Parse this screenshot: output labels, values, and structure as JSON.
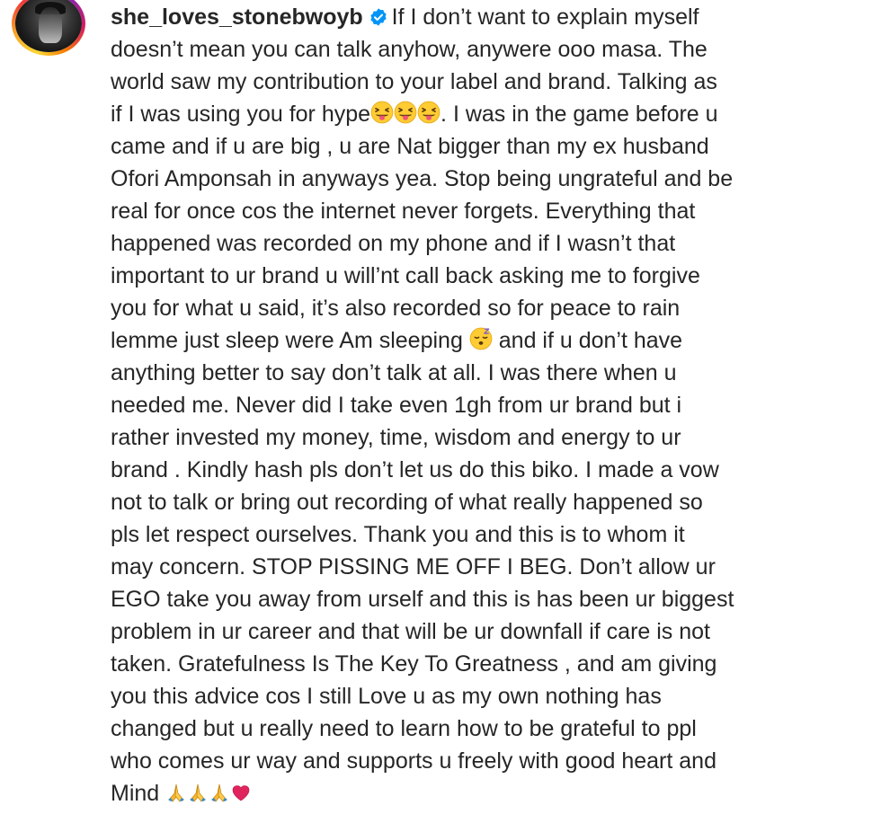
{
  "post": {
    "username": "she_loves_stonebwoyb",
    "verified": true,
    "caption_lines": [
      "If I don’t want to explain myself",
      "doesn’t mean you can talk anyhow, anywere ooo masa. The",
      "world saw my contribution to your label and brand. Talking as",
      "if I was using you for hype",
      ". I was in the game before u",
      "came and if u are big , u are Nat bigger than my ex husband",
      "Ofori Amponsah in anyways yea. Stop being ungrateful and be",
      "real for once cos the internet never forgets. Everything that",
      "happened was recorded on my phone and if I wasn’t that",
      "important to ur brand u will’nt call back asking me to forgive",
      "you for what u said, it’s also recorded so for peace to rain",
      "lemme just sleep were Am sleeping",
      "and if u don’t have",
      "anything better to say don’t talk at all. I was there when u",
      "needed me. Never did I take even 1gh from ur brand but i",
      "rather invested my money, time, wisdom and energy to ur",
      "brand . Kindly hash pls don’t let us do this biko. I made a vow",
      "not to talk or bring out recording of what really happened so",
      "pls let respect ourselves. Thank you and this is to whom it",
      "may concern. STOP PISSING ME OFF I BEG. Don’t allow ur",
      "EGO take you away from urself and this is has been ur biggest",
      "problem in ur career and that will be ur downfall if care is not",
      "taken. Gratefulness Is The Key To Greatness , and am giving",
      "you this advice cos I still Love u as my own nothing has",
      "changed but u really need to learn how to be grateful to ppl",
      "who comes ur way and supports u freely with good heart and",
      "Mind"
    ],
    "icons": {
      "verified": "verified-badge-icon",
      "tongue": "squinting-face-with-tongue-emoji",
      "sleeping": "sleeping-face-emoji",
      "pray": "folded-hands-emoji",
      "heart": "red-heart-emoji"
    },
    "colors": {
      "text": "#262626",
      "verified": "#0095f6",
      "heart": "#e0245e"
    }
  }
}
